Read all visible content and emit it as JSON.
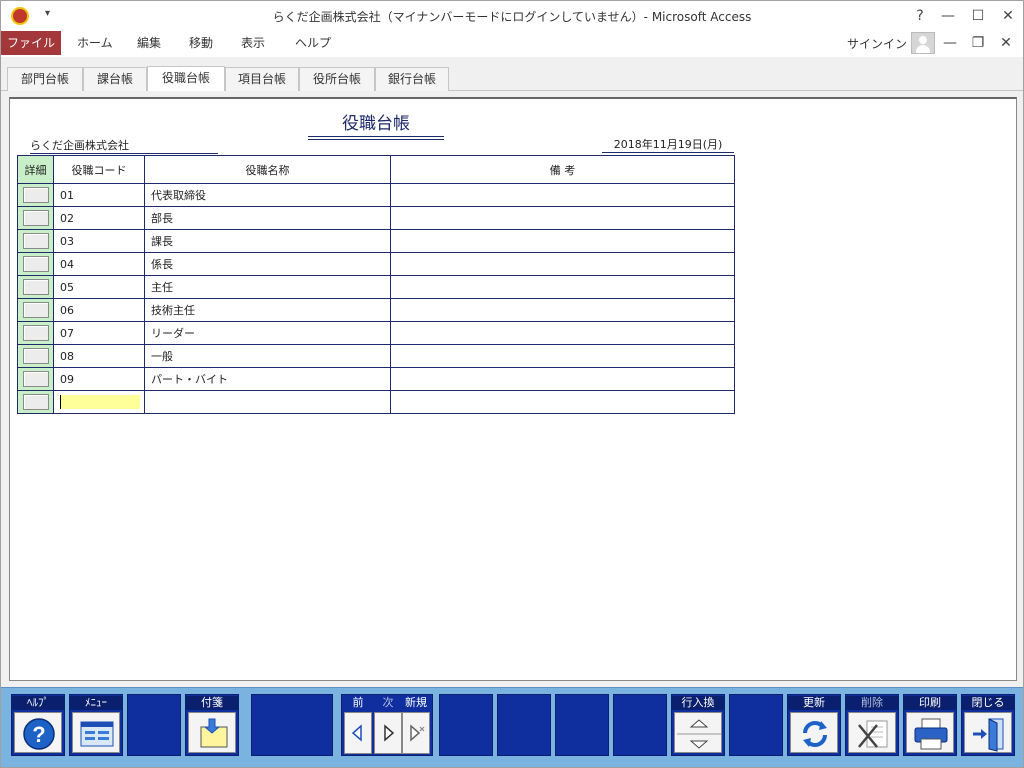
{
  "window": {
    "title": "らくだ企画株式会社（マイナンバーモードにログインしていません）- Microsoft Access",
    "qat_arrow": "▾",
    "help": "?",
    "minimize": "—",
    "maximize": "☐",
    "close": "✕"
  },
  "menubar": {
    "items": [
      "ファイル",
      "ホーム",
      "編集",
      "移動",
      "表示",
      "ヘルプ"
    ],
    "signin": "サインイン",
    "inner_minimize": "—",
    "inner_restore": "❐",
    "inner_close": "✕"
  },
  "tabs": [
    "部門台帳",
    "課台帳",
    "役職台帳",
    "項目台帳",
    "役所台帳",
    "銀行台帳"
  ],
  "active_tab": "役職台帳",
  "form": {
    "title": "役職台帳",
    "company": "らくだ企画株式会社",
    "date": "2018年11月19日(月)",
    "columns": [
      "詳細",
      "役職コード",
      "役職名称",
      "備 考"
    ],
    "rows": [
      {
        "code": "01",
        "name": "代表取締役",
        "note": ""
      },
      {
        "code": "02",
        "name": "部長",
        "note": ""
      },
      {
        "code": "03",
        "name": "課長",
        "note": ""
      },
      {
        "code": "04",
        "name": "係長",
        "note": ""
      },
      {
        "code": "05",
        "name": "主任",
        "note": ""
      },
      {
        "code": "06",
        "name": "技術主任",
        "note": ""
      },
      {
        "code": "07",
        "name": "リーダー",
        "note": ""
      },
      {
        "code": "08",
        "name": "一般",
        "note": ""
      },
      {
        "code": "09",
        "name": "パート・バイト",
        "note": ""
      }
    ]
  },
  "toolbar": {
    "help": "ﾍﾙﾌﾟ",
    "menu": "ﾒﾆｭｰ",
    "sticky": "付箋",
    "prev": "前",
    "next": "次",
    "new": "新規",
    "row_swap": "行入換",
    "update": "更新",
    "delete": "削除",
    "print": "印刷",
    "close": "閉じる"
  },
  "colors": {
    "file_menu": "#a4373a",
    "toolbar_bg": "#7bb3e0",
    "button_blue": "#0f2f9e",
    "detail_green": "#c9efc9",
    "new_row_yellow": "#ffff99"
  }
}
